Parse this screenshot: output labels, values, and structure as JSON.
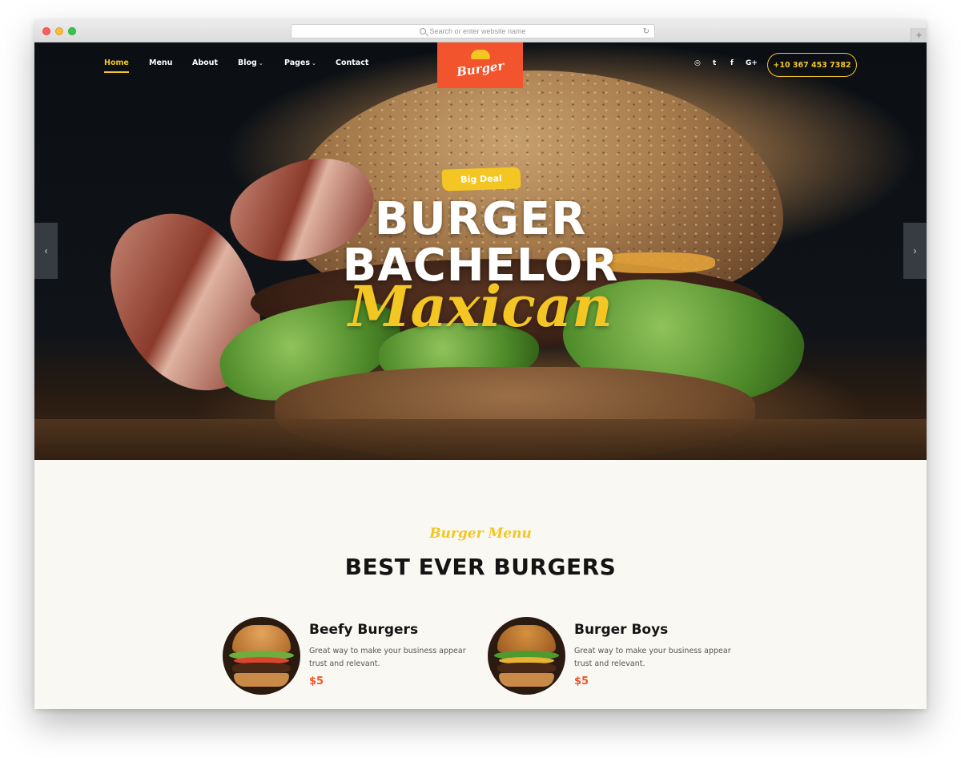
{
  "browser": {
    "url_placeholder": "Search or enter website name",
    "new_tab": "+"
  },
  "nav": {
    "items": [
      {
        "label": "Home",
        "active": true
      },
      {
        "label": "Menu"
      },
      {
        "label": "About"
      },
      {
        "label": "Blog",
        "dropdown": true
      },
      {
        "label": "Pages",
        "dropdown": true
      },
      {
        "label": "Contact"
      }
    ],
    "logo_text": "Burger",
    "social": [
      "instagram-icon",
      "twitter-icon",
      "facebook-icon",
      "google-plus-icon"
    ],
    "social_glyphs": [
      "◎",
      "t",
      "f",
      "G+"
    ],
    "phone": "+10 367 453 7382"
  },
  "hero": {
    "badge": "Big Deal",
    "line1": "BURGER",
    "line2": "BACHELOR",
    "script": "Maxican",
    "prev_glyph": "‹",
    "next_glyph": "›"
  },
  "menu_section": {
    "subtitle": "Burger Menu",
    "title": "BEST EVER BURGERS",
    "cards": [
      {
        "title": "Beefy Burgers",
        "description": "Great way to make your business appear trust and relevant.",
        "price": "$5"
      },
      {
        "title": "Burger Boys",
        "description": "Great way to make your business appear trust and relevant.",
        "price": "$5"
      }
    ]
  },
  "colors": {
    "accent": "#f3c623",
    "brand": "#f2542d",
    "dark": "#141414"
  }
}
